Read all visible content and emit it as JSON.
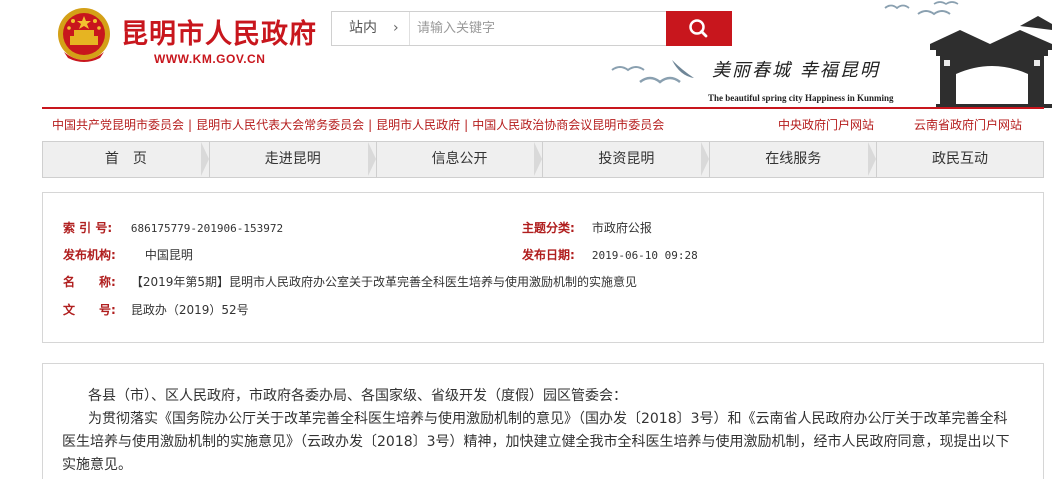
{
  "header": {
    "site_title": "昆明市人民政府",
    "site_url": "WWW.KM.GOV.CN",
    "slogan": "美丽春城  幸福昆明",
    "slogan_en": "The beautiful spring city  Happiness in Kunming"
  },
  "search": {
    "scope": "站内",
    "placeholder": "请输入关键字"
  },
  "links": {
    "left": [
      "中国共产党昆明市委员会",
      "昆明市人民代表大会常务委员会",
      "昆明市人民政府",
      "中国人民政治协商会议昆明市委员会"
    ],
    "right": [
      "中央政府门户网站",
      "云南省政府门户网站"
    ]
  },
  "nav": [
    "首　页",
    "走进昆明",
    "信息公开",
    "投资昆明",
    "在线服务",
    "政民互动"
  ],
  "info": {
    "index_label": "索 引 号:",
    "index_value": "686175779-201906-153972",
    "category_label": "主题分类:",
    "category_value": "市政府公报",
    "publisher_label": "发布机构:",
    "publisher_value": "中国昆明",
    "date_label": "发布日期:",
    "date_value": "2019-06-10 09:28",
    "name_label": "名　　称:",
    "name_value": "【2019年第5期】昆明市人民政府办公室关于改革完善全科医生培养与使用激励机制的实施意见",
    "docno_label": "文　　号:",
    "docno_value": "昆政办（2019）52号"
  },
  "body": {
    "line1": "各县（市）、区人民政府，市政府各委办局、各国家级、省级开发（度假）园区管委会：",
    "line2": "为贯彻落实《国务院办公厅关于改革完善全科医生培养与使用激励机制的意见》（国办发〔2018〕3号）和《云南省人民政府办公厅关于改革完善全科",
    "line3": "医生培养与使用激励机制的实施意见》（云政办发〔2018〕3号）精神，加快建立健全我市全科医生培养与使用激励机制，经市人民政府同意，现提出以下",
    "line4": "实施意见。"
  },
  "colors": {
    "brand_red": "#c8161d",
    "label_red": "#b01e1e",
    "nav_bg": "#efefef"
  },
  "icons": {
    "emblem": "national-emblem-icon",
    "search": "search-icon",
    "chevron": "chevron-right-icon"
  }
}
